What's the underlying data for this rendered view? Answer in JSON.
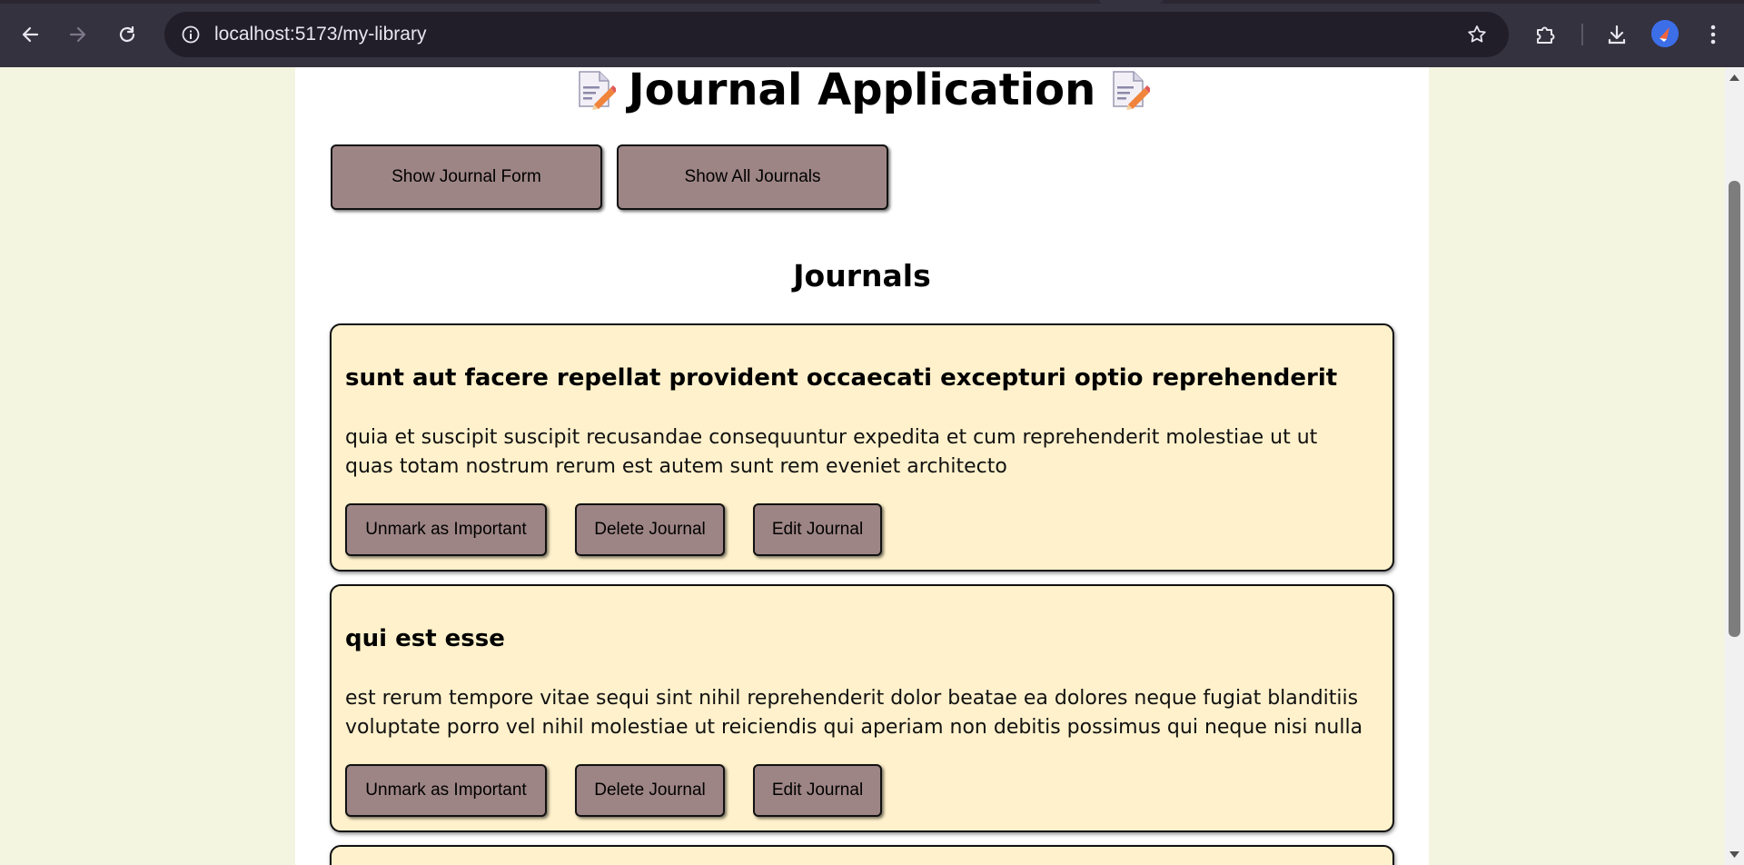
{
  "browser": {
    "url_host": "localhost",
    "url_path": ":5173/my-library"
  },
  "app": {
    "title": "Journal Application",
    "buttons": {
      "show_form": "Show Journal Form",
      "show_all": "Show All Journals"
    },
    "section_title": "Journals",
    "journals": [
      {
        "title": "sunt aut facere repellat provident occaecati excepturi optio reprehenderit",
        "body": "quia et suscipit suscipit recusandae consequuntur expedita et cum reprehenderit molestiae ut ut quas totam nostrum rerum est autem sunt rem eveniet architecto",
        "unmark_label": "Unmark as Important",
        "delete_label": "Delete Journal",
        "edit_label": "Edit Journal"
      },
      {
        "title": "qui est esse",
        "body": "est rerum tempore vitae sequi sint nihil reprehenderit dolor beatae ea dolores neque fugiat blanditiis voluptate porro vel nihil molestiae ut reiciendis qui aperiam non debitis possimus qui neque nisi nulla",
        "unmark_label": "Unmark as Important",
        "delete_label": "Delete Journal",
        "edit_label": "Edit Journal"
      }
    ]
  },
  "icons": {
    "back": "arrow-left-icon",
    "forward": "arrow-right-icon",
    "reload": "reload-icon",
    "site_info": "info-icon",
    "bookmark": "star-icon",
    "extensions": "puzzle-icon",
    "downloads": "download-icon",
    "menu": "kebab-menu-icon",
    "title_decoration": "memo-icon"
  }
}
